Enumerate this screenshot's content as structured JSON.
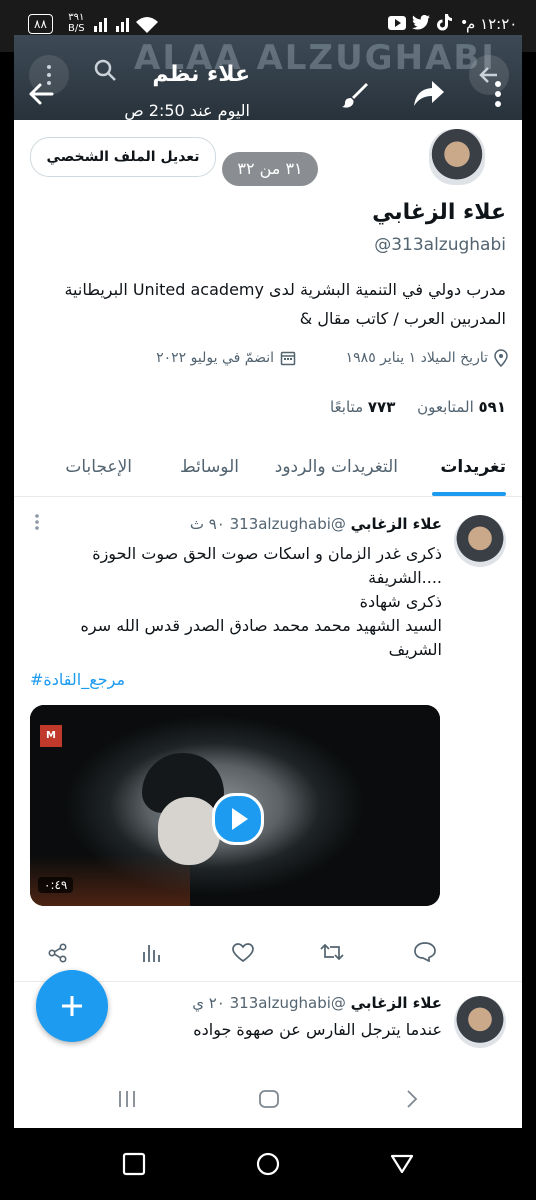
{
  "status_bar": {
    "time": "١٢:٢٠ م",
    "battery": "٨٨",
    "net_speed": "٣٩١",
    "net_unit": "B/S"
  },
  "viewer": {
    "watermark": "ALAA ALZUGHABI",
    "sender_name": "علاء نظم",
    "timestamp": "اليوم عند 2:50 ص",
    "counter": "٣١ من ٣٢"
  },
  "profile": {
    "edit_button": "تعديل الملف الشخصي",
    "name": "علاء الزغابي",
    "handle": "@313alzughabi",
    "bio_line1": "مدرب دولي في التنمية البشرية لدى United academy البريطانية",
    "bio_line2": "& المدربين العرب / كاتب مقال",
    "birthdate": "تاريخ الميلاد ١ يناير ١٩٨٥",
    "joined": "انضمّ في يوليو ٢٠٢٢",
    "followers_count": "٥٩١",
    "followers_label": "المتابعون",
    "following_count": "٧٧٣",
    "following_label": "متابعًا"
  },
  "tabs": [
    "تغريدات",
    "التغريدات والردود",
    "الوسائط",
    "الإعجابات"
  ],
  "tweets": [
    {
      "name": "علاء الزغابي",
      "handle": "@313alzughabi",
      "time": "٩٠ ث",
      "lines": [
        "ذكرى غدر الزمان و اسكات صوت الحق صوت الحوزة",
        "الشريفة....",
        "ذكرى شهادة",
        "السيد الشهيد محمد محمد صادق الصدر قدس الله سره",
        "الشريف"
      ],
      "hashtag": "#مرجع_القادة",
      "video_duration": "٠:٤٩"
    },
    {
      "name": "علاء الزغابي",
      "handle": "@313alzughabi",
      "time": "٢٠ ي",
      "lines": [
        "عندما يترجل الفارس عن صهوة جواده"
      ]
    }
  ],
  "colors": {
    "accent": "#1d9bf0",
    "text": "#0f1419",
    "muted": "#536471"
  }
}
